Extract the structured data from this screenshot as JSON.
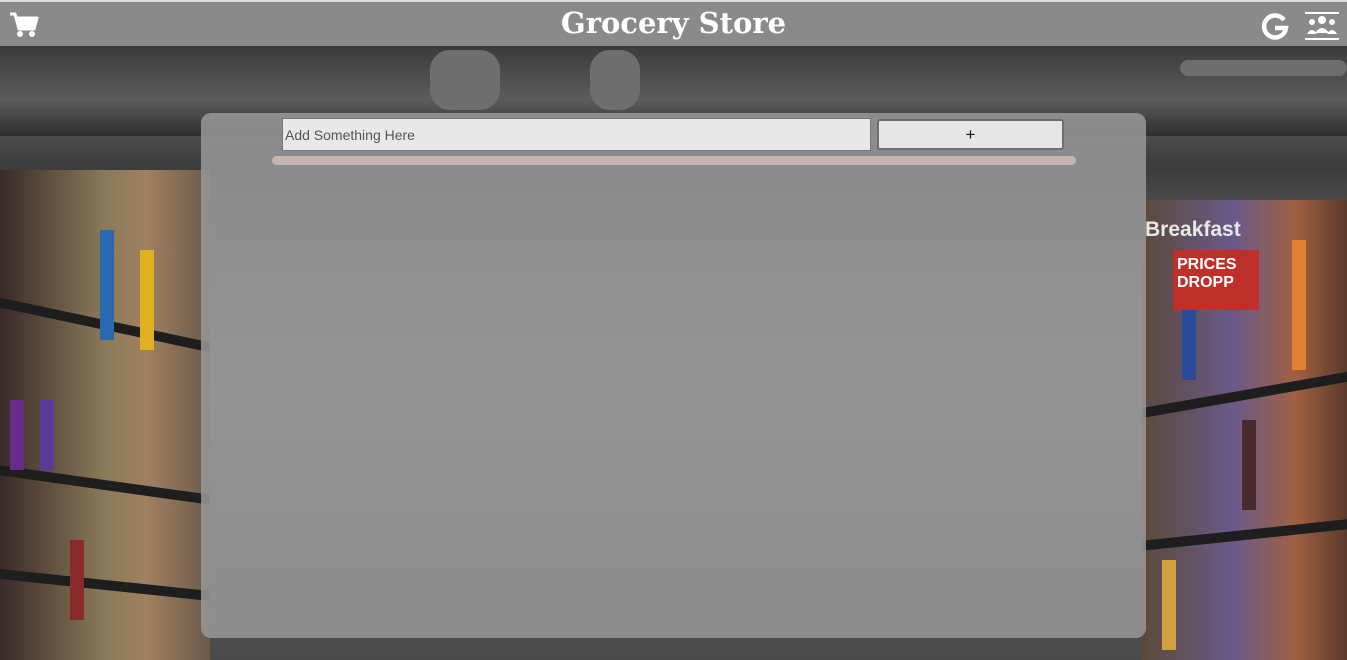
{
  "header": {
    "title": "Grocery Store",
    "icons": [
      "cart-icon",
      "google-icon",
      "users-group-icon"
    ]
  },
  "add_form": {
    "placeholder": "Add Something Here",
    "value": "",
    "add_label": "+"
  },
  "colors": {
    "header_bg": "#8a8a8a",
    "panel_bg": "#969696",
    "progress_track": "#c4b4b4"
  }
}
